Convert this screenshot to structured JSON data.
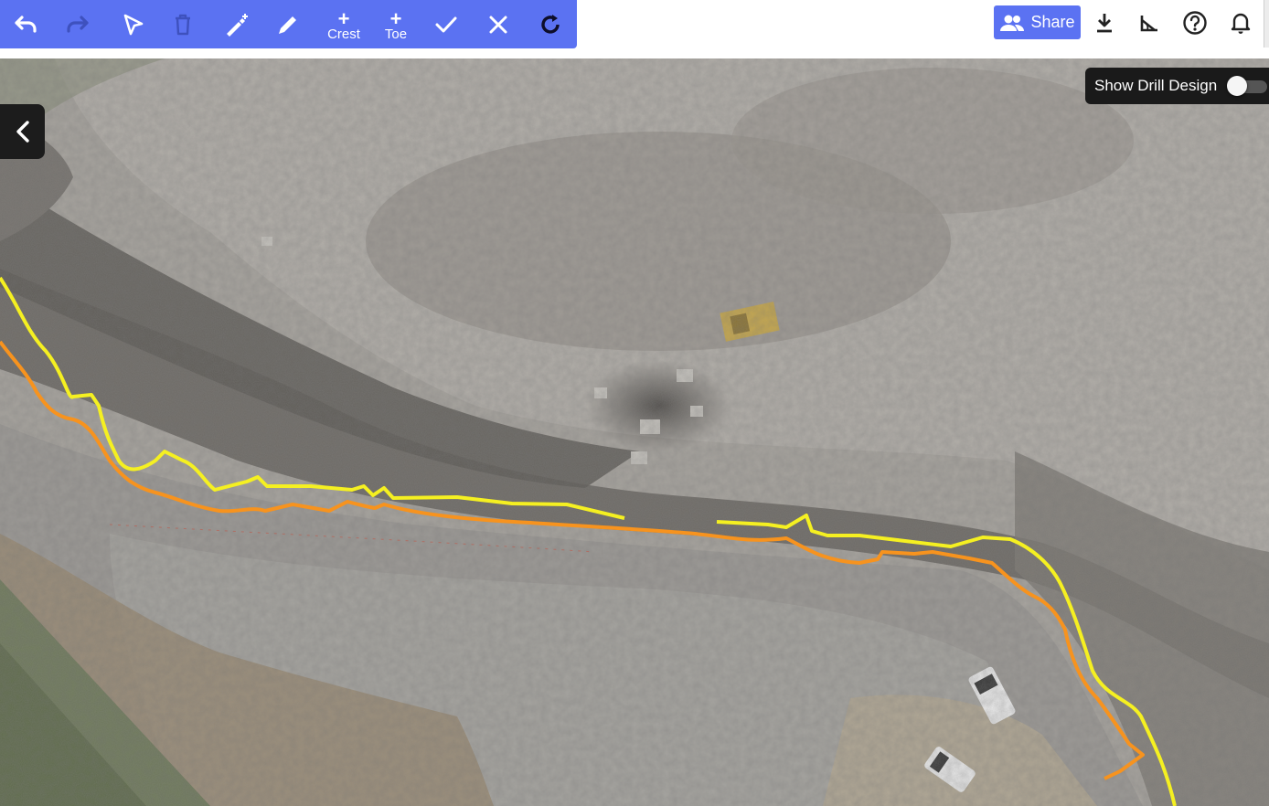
{
  "toolbar": {
    "tools": [
      {
        "name": "undo-icon",
        "label": ""
      },
      {
        "name": "redo-icon",
        "label": ""
      },
      {
        "name": "select-pointer-icon",
        "label": ""
      },
      {
        "name": "delete-icon",
        "label": ""
      },
      {
        "name": "magic-draw-icon",
        "label": ""
      },
      {
        "name": "pencil-icon",
        "label": ""
      },
      {
        "name": "add-crest",
        "label": "Crest"
      },
      {
        "name": "add-toe",
        "label": "Toe"
      },
      {
        "name": "check-icon",
        "label": ""
      },
      {
        "name": "close-icon",
        "label": ""
      },
      {
        "name": "rotate-icon",
        "label": ""
      }
    ],
    "crest_label": "Crest",
    "toe_label": "Toe",
    "plus_symbol": "+",
    "color": "#5b72f2"
  },
  "header": {
    "share_label": "Share",
    "icons": [
      "people-icon",
      "download-icon",
      "measure-angle-icon",
      "help-icon",
      "bell-icon"
    ]
  },
  "map": {
    "drill_toggle_label": "Show Drill Design",
    "drill_toggle_on": false,
    "crest_line_color": "#f5f021",
    "toe_line_color": "#f7931e"
  }
}
